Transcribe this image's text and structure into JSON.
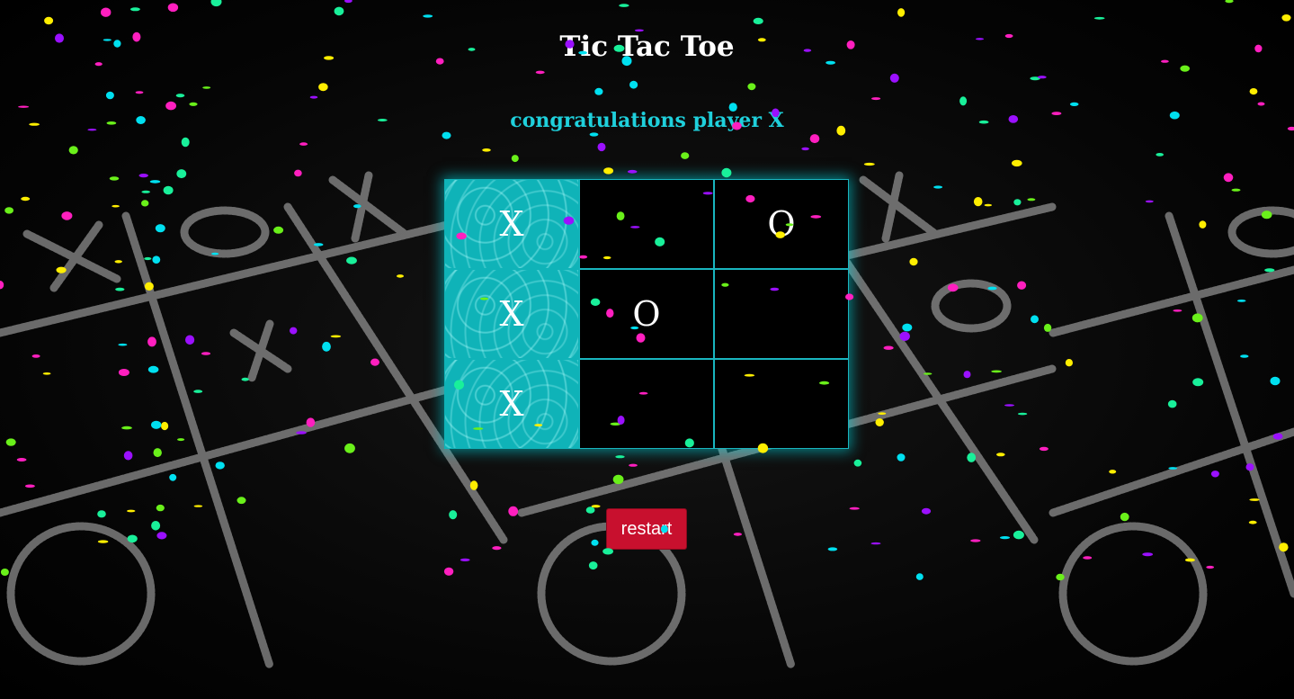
{
  "page": {
    "title": "Tic Tac Toe",
    "status": "congratulations player X",
    "restart_label": "restart"
  },
  "board": {
    "cells": [
      "X",
      "",
      "O",
      "X",
      "O",
      "",
      "X",
      "",
      ""
    ],
    "winning_cells": [
      0,
      3,
      6
    ]
  },
  "colors": {
    "status_text": "#1fd0dc",
    "board_border": "#19b6c0",
    "win_cell": "#0fb3b8",
    "restart_button": "#c8102e",
    "confetti": [
      "#ff1fbf",
      "#ffee00",
      "#9b10ff",
      "#00e0f0",
      "#19f09a",
      "#6af01a"
    ]
  }
}
